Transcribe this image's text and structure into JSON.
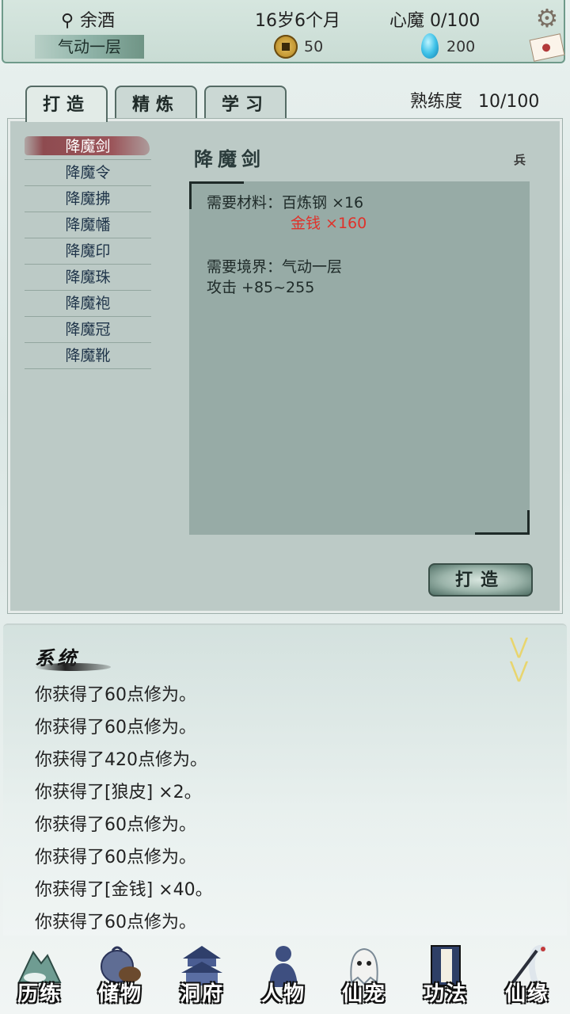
{
  "status": {
    "name": "余酒",
    "realm": "气动一层",
    "age": "16岁6个月",
    "demon": "心魔 0/100",
    "coins": "50",
    "gems": "200"
  },
  "tabs": [
    {
      "label": "打造"
    },
    {
      "label": "精炼"
    },
    {
      "label": "学习"
    }
  ],
  "proficiency": {
    "label": "熟练度",
    "value": "10/100"
  },
  "items": [
    "降魔剑",
    "降魔令",
    "降魔拂",
    "降魔幡",
    "降魔印",
    "降魔珠",
    "降魔袍",
    "降魔冠",
    "降魔靴"
  ],
  "selected_item": "降魔剑",
  "detail": {
    "title": "降魔剑",
    "type_tag": "兵",
    "material_line": "需要材料：百炼钢 ×16",
    "money_line": "金钱 ×160",
    "realm_line": "需要境界：气动一层",
    "attack_line": "攻击 +85~255"
  },
  "forge_button": "打造",
  "log": {
    "title": "系统",
    "entries": [
      "你获得了60点修为。",
      "你获得了60点修为。",
      "你获得了420点修为。",
      "你获得了[狼皮] ×2。",
      "你获得了60点修为。",
      "你获得了60点修为。",
      "你获得了[金钱] ×40。",
      "你获得了60点修为。"
    ]
  },
  "nav": [
    {
      "label": "历练",
      "icon": "mountain-icon"
    },
    {
      "label": "储物",
      "icon": "bag-icon"
    },
    {
      "label": "洞府",
      "icon": "palace-icon"
    },
    {
      "label": "人物",
      "icon": "person-icon"
    },
    {
      "label": "仙宠",
      "icon": "ghost-pet-icon"
    },
    {
      "label": "功法",
      "icon": "book-icon"
    },
    {
      "label": "仙缘",
      "icon": "crane-icon"
    }
  ],
  "colors": {
    "money_red": "#e0312a",
    "panel": "#bccac6"
  }
}
